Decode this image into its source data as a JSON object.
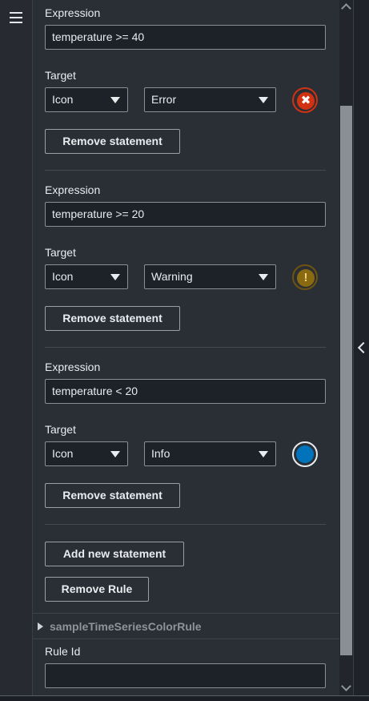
{
  "labels": {
    "expression": "Expression",
    "target": "Target",
    "rule_id": "Rule Id"
  },
  "statements": [
    {
      "expression": "temperature >= 40",
      "target_type": "Icon",
      "target_value": "Error",
      "icon": "error-icon",
      "icon_color": "#d13212",
      "remove_label": "Remove statement"
    },
    {
      "expression": "temperature >= 20",
      "target_type": "Icon",
      "target_value": "Warning",
      "icon": "warning-icon",
      "icon_color": "#8a6a10",
      "remove_label": "Remove statement"
    },
    {
      "expression": "temperature < 20",
      "target_type": "Icon",
      "target_value": "Info",
      "icon": "info-icon",
      "icon_color": "#0073bb",
      "remove_label": "Remove statement"
    }
  ],
  "actions": {
    "add_statement_label": "Add new statement",
    "remove_rule_label": "Remove Rule"
  },
  "next_rule": {
    "name": "sampleTimeSeriesColorRule"
  },
  "rule_id_value": "",
  "icons": {
    "menu": "menu-icon",
    "collapse": "chevron-left-icon",
    "expand": "caret-right-icon"
  }
}
